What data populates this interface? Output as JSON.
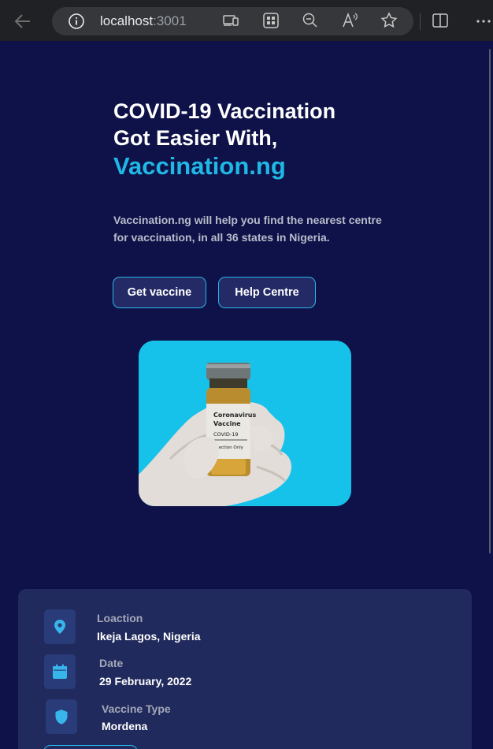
{
  "browser": {
    "url_host": "localhost",
    "url_port": ":3001"
  },
  "hero": {
    "title_line1": "COVID-19 Vaccination",
    "title_line2": "Got Easier With,",
    "brand": "Vaccination.ng",
    "subtitle": "Vaccination.ng will help you find the nearest centre for vaccination, in all 36 states in Nigeria.",
    "buttons": {
      "get_vaccine": "Get vaccine",
      "help_centre": "Help Centre"
    },
    "vial_label": {
      "line1": "Coronavirus",
      "line2": "Vaccine",
      "line3": "COVID-19",
      "line4": "Injection Only"
    }
  },
  "info_card": {
    "location_label": "Loaction",
    "location_value": "Ikeja Lagos, Nigeria",
    "date_label": "Date",
    "date_value": "29 February, 2022",
    "type_label": "Vaccine Type",
    "type_value": "Mordena"
  },
  "colors": {
    "background": "#0f1248",
    "accent": "#1fb8e6",
    "card": "#212a5c"
  }
}
